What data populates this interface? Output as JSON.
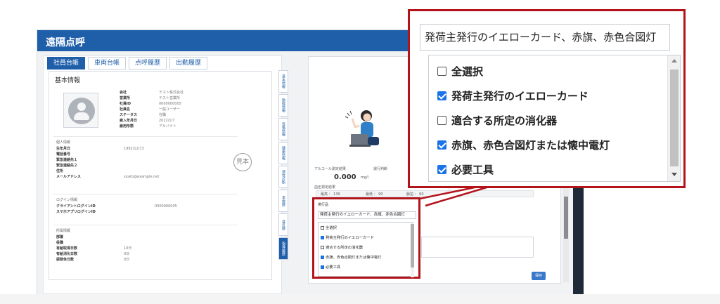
{
  "app": {
    "title": "遠隔点呼",
    "tabs": [
      "社員台帳",
      "車両台帳",
      "点呼履歴",
      "出勤履歴"
    ]
  },
  "basic_info": {
    "section_title": "基本情報",
    "fields": [
      {
        "key": "会社",
        "value": "テスト株式会社"
      },
      {
        "key": "営業所",
        "value": "テスト営業所"
      },
      {
        "key": "社員ID",
        "value": "0000000005"
      },
      {
        "key": "社員名",
        "value": "一般ユーザー"
      },
      {
        "key": "ステータス",
        "value": "在職"
      },
      {
        "key": "雇入年月日",
        "value": "2022/1/7"
      },
      {
        "key": "雇用形態",
        "value": "アルバイト"
      }
    ]
  },
  "personal_info": {
    "section_title": "個人情報",
    "fields": [
      {
        "key": "生年月日",
        "value": "1992/12/13"
      },
      {
        "key": "電話番号",
        "value": ""
      },
      {
        "key": "緊急連絡先１",
        "value": ""
      },
      {
        "key": "緊急連絡先２",
        "value": ""
      },
      {
        "key": "住所",
        "value": ""
      },
      {
        "key": "メールアドレス",
        "value": "xxato@example.net"
      }
    ],
    "stamp": "見本"
  },
  "login_info": {
    "section_title": "ログイン情報",
    "fields": [
      {
        "key": "クライアントログインID",
        "value": "0000000005"
      },
      {
        "key": "スマホアプリログインID",
        "value": ""
      }
    ]
  },
  "work_info": {
    "section_title": "所属情報",
    "fields": [
      {
        "key": "部署",
        "value": ""
      },
      {
        "key": "役職",
        "value": ""
      },
      {
        "key": "有給取得日数",
        "value": "10日"
      },
      {
        "key": "有給消化日数",
        "value": "0日"
      },
      {
        "key": "振替休日数",
        "value": "0日"
      }
    ]
  },
  "vertical_tabs": [
    "基本情報",
    "勤務情報",
    "資格情報",
    "健康情報",
    "適性診断",
    "事故歴",
    "違反歴",
    "指導履歴"
  ],
  "alcohol": {
    "label": "アルコール測定結果",
    "judge_label": "運行判断",
    "value": "0.000",
    "unit": "mg/l",
    "bp_label": "血圧測定結果",
    "bp_high": "最高 ： 130",
    "bp_low": "最低 ： 90",
    "bp_pulse": "脈拍 ： 60",
    "save": "保存"
  },
  "belongings_small": {
    "title": "携行品",
    "input": "発荷主発行のイエローカード、赤旗、赤色合図灯",
    "items": [
      {
        "label": "全選択",
        "checked": false
      },
      {
        "label": "発荷主発行のイエローカード",
        "checked": true
      },
      {
        "label": "適合する所定の消化器",
        "checked": false
      },
      {
        "label": "赤旗、赤色合図灯または懐中電灯",
        "checked": true
      },
      {
        "label": "必要工具",
        "checked": true
      }
    ]
  },
  "belongings_zoom": {
    "input": "発荷主発行のイエローカード、赤旗、赤色合図灯",
    "items": [
      {
        "label": "全選択",
        "checked": false
      },
      {
        "label": "発荷主発行のイエローカード",
        "checked": true
      },
      {
        "label": "適合する所定の消化器",
        "checked": false
      },
      {
        "label": "赤旗、赤色合図灯または懐中電灯",
        "checked": true
      },
      {
        "label": "必要工具",
        "checked": true
      }
    ]
  },
  "colors": {
    "brand": "#1f5faa",
    "callout": "#b3141c",
    "checkbox": "#1b73e8"
  }
}
